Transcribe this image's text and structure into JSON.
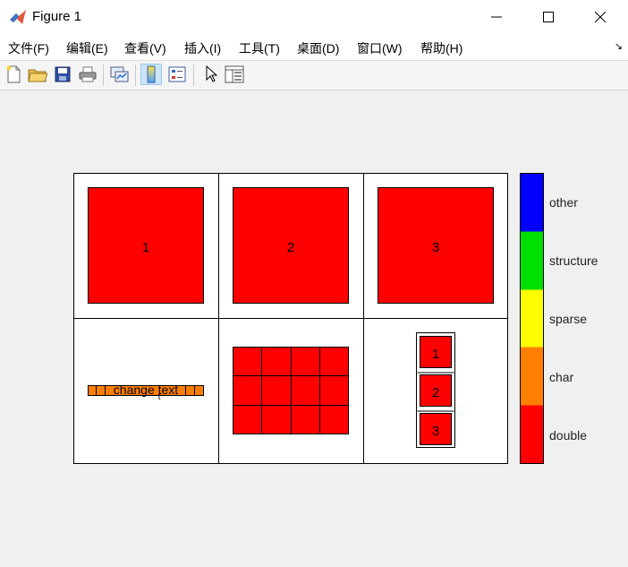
{
  "window": {
    "title": "Figure 1"
  },
  "menu": {
    "items": [
      "文件(F)",
      "编辑(E)",
      "查看(V)",
      "插入(I)",
      "工具(T)",
      "桌面(D)",
      "窗口(W)",
      "帮助(H)"
    ],
    "overflow_arrow": "↘"
  },
  "toolbar": {
    "buttons": [
      "new-file-icon",
      "open-folder-icon",
      "save-icon",
      "print-icon",
      "link-plot-icon",
      "colorbar-icon",
      "legend-icon",
      "pointer-icon",
      "property-inspector-icon"
    ]
  },
  "figure": {
    "cells": {
      "c1": {
        "label": "1"
      },
      "c2": {
        "label": "2"
      },
      "c3": {
        "label": "3"
      },
      "c4": {
        "label": "change text",
        "cursor": "t"
      },
      "c6": {
        "items": [
          "1",
          "2",
          "3"
        ]
      }
    },
    "colors": {
      "double": "#ff0000",
      "char": "#ff7f00",
      "sparse": "#ffff00",
      "structure": "#00e000",
      "other": "#0000ff"
    },
    "colorbar": {
      "labels": [
        "other",
        "structure",
        "sparse",
        "char",
        "double"
      ]
    }
  }
}
